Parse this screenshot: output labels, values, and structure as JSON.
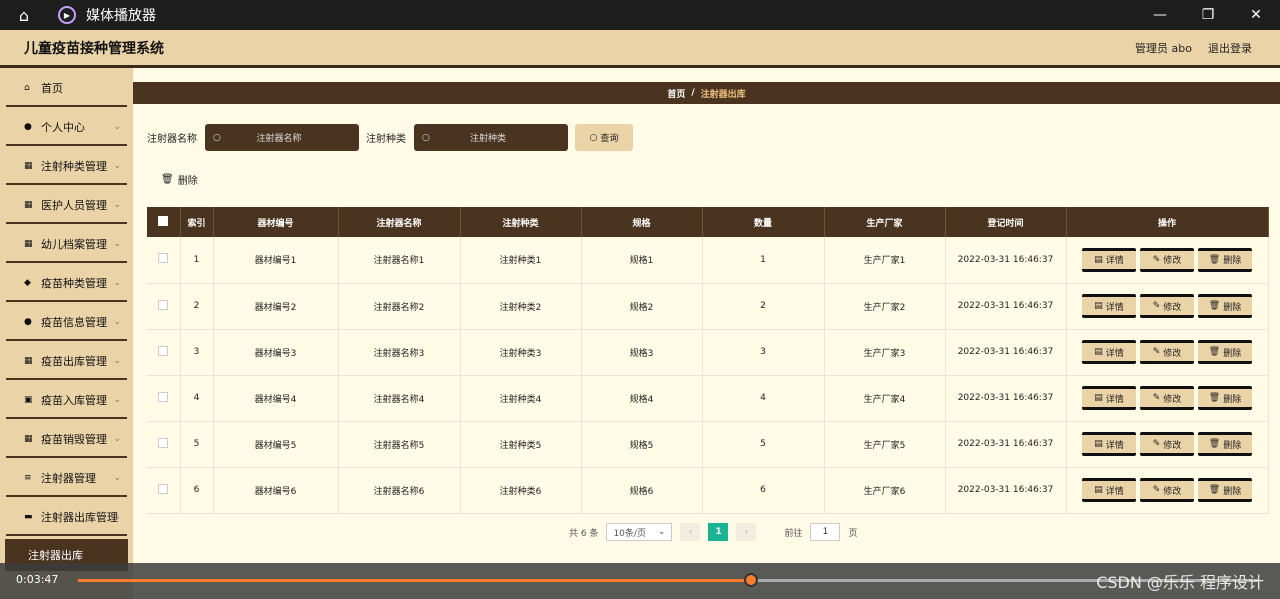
{
  "player": {
    "title": "媒体播放器",
    "time": "0:03:47",
    "progress": 0.57,
    "watermark": "CSDN @乐乐 程序设计"
  },
  "header": {
    "title": "儿童疫苗接种管理系统",
    "user": "管理员 abo",
    "logout": "退出登录"
  },
  "sidebar": {
    "items": [
      {
        "label": "首页",
        "icon": "home-icon",
        "glyph": "⌂",
        "has_chevron": false
      },
      {
        "label": "个人中心",
        "icon": "user-icon",
        "glyph": "●",
        "has_chevron": true
      },
      {
        "label": "注射种类管理",
        "icon": "grid-icon",
        "glyph": "▦",
        "has_chevron": true
      },
      {
        "label": "医护人员管理",
        "icon": "grid-icon",
        "glyph": "▦",
        "has_chevron": true
      },
      {
        "label": "幼儿档案管理",
        "icon": "grid-icon",
        "glyph": "▦",
        "has_chevron": true
      },
      {
        "label": "疫苗种类管理",
        "icon": "thumb-icon",
        "glyph": "◆",
        "has_chevron": true
      },
      {
        "label": "疫苗信息管理",
        "icon": "user-icon",
        "glyph": "●",
        "has_chevron": true
      },
      {
        "label": "疫苗出库管理",
        "icon": "grid-icon",
        "glyph": "▦",
        "has_chevron": true
      },
      {
        "label": "疫苗入库管理",
        "icon": "clipboard-icon",
        "glyph": "▣",
        "has_chevron": true
      },
      {
        "label": "疫苗销毁管理",
        "icon": "grid-icon",
        "glyph": "▦",
        "has_chevron": true
      },
      {
        "label": "注射器管理",
        "icon": "list-icon",
        "glyph": "≡",
        "has_chevron": true
      },
      {
        "label": "注射器出库管理",
        "icon": "comment-icon",
        "glyph": "▬",
        "has_chevron": true
      }
    ],
    "active_sub": "注射器出库"
  },
  "breadcrumb": {
    "home": "首页",
    "sep": "/",
    "current": "注射器出库"
  },
  "search": {
    "label1": "注射器名称",
    "placeholder1": "注射器名称",
    "label2": "注射种类",
    "placeholder2": "注射种类",
    "query": "查询"
  },
  "actions": {
    "delete": "删除"
  },
  "table": {
    "headers": [
      "索引",
      "器材编号",
      "注射器名称",
      "注射种类",
      "规格",
      "数量",
      "生产厂家",
      "登记时间",
      "操作"
    ],
    "rows": [
      {
        "idx": "1",
        "code": "器材编号1",
        "name": "注射器名称1",
        "type": "注射种类1",
        "spec": "规格1",
        "qty": "1",
        "maker": "生产厂家1",
        "time": "2022-03-31 16:46:37"
      },
      {
        "idx": "2",
        "code": "器材编号2",
        "name": "注射器名称2",
        "type": "注射种类2",
        "spec": "规格2",
        "qty": "2",
        "maker": "生产厂家2",
        "time": "2022-03-31 16:46:37"
      },
      {
        "idx": "3",
        "code": "器材编号3",
        "name": "注射器名称3",
        "type": "注射种类3",
        "spec": "规格3",
        "qty": "3",
        "maker": "生产厂家3",
        "time": "2022-03-31 16:46:37"
      },
      {
        "idx": "4",
        "code": "器材编号4",
        "name": "注射器名称4",
        "type": "注射种类4",
        "spec": "规格4",
        "qty": "4",
        "maker": "生产厂家4",
        "time": "2022-03-31 16:46:37"
      },
      {
        "idx": "5",
        "code": "器材编号5",
        "name": "注射器名称5",
        "type": "注射种类5",
        "spec": "规格5",
        "qty": "5",
        "maker": "生产厂家5",
        "time": "2022-03-31 16:46:37"
      },
      {
        "idx": "6",
        "code": "器材编号6",
        "name": "注射器名称6",
        "type": "注射种类6",
        "spec": "规格6",
        "qty": "6",
        "maker": "生产厂家6",
        "time": "2022-03-31 16:46:37"
      }
    ],
    "ops": {
      "detail": "详情",
      "edit": "修改",
      "delete": "删除"
    }
  },
  "pager": {
    "total": "共 6 条",
    "size": "10条/页",
    "page": "1",
    "goto": "前往",
    "goto_value": "1",
    "unit": "页"
  }
}
